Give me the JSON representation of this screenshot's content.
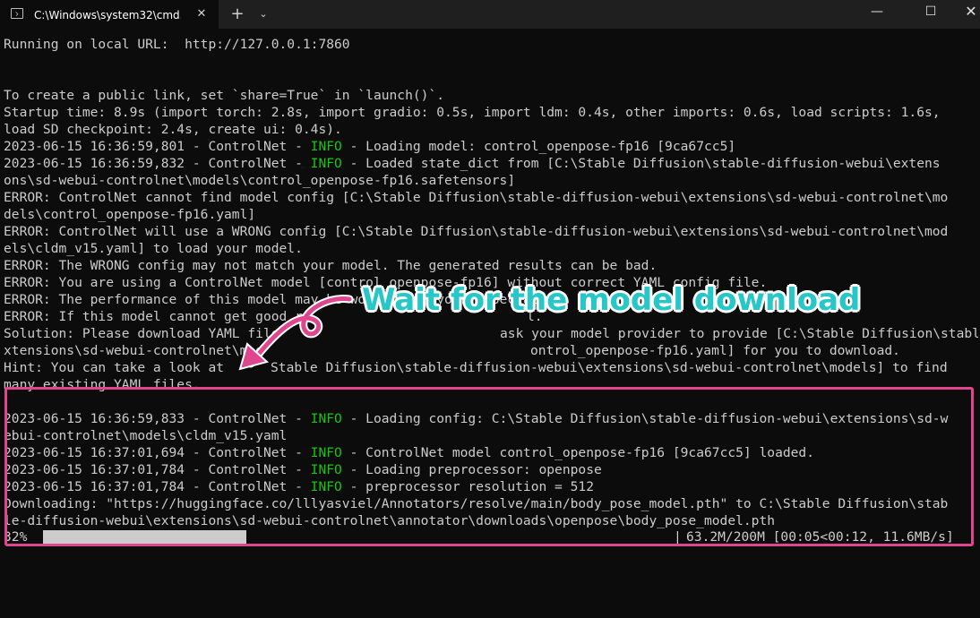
{
  "window": {
    "tab_title": "C:\\Windows\\system32\\cmd.e",
    "tab_close": "✕",
    "new_tab": "+",
    "dropdown": "⌄",
    "minimize": "—",
    "maximize": "☐",
    "close": "✕"
  },
  "console": {
    "lines": [
      "Running on local URL:  http://127.0.0.1:7860",
      "",
      "",
      "To create a public link, set `share=True` in `launch()`.",
      "Startup time: 8.9s (import torch: 2.8s, import gradio: 0.5s, import ldm: 0.4s, other imports: 0.6s, load scripts: 1.6s,",
      "load SD checkpoint: 2.4s, create ui: 0.4s).",
      [
        "2023-06-15 16:36:59,801 - ControlNet - ",
        "INFO",
        " - Loading model: control_openpose-fp16 [9ca67cc5]"
      ],
      [
        "2023-06-15 16:36:59,832 - ControlNet - ",
        "INFO",
        " - Loaded state_dict from [C:\\Stable Diffusion\\stable-diffusion-webui\\extens"
      ],
      "ons\\sd-webui-controlnet\\models\\control_openpose-fp16.safetensors]",
      "ERROR: ControlNet cannot find model config [C:\\Stable Diffusion\\stable-diffusion-webui\\extensions\\sd-webui-controlnet\\mo",
      "dels\\control_openpose-fp16.yaml]",
      "ERROR: ControlNet will use a WRONG config [C:\\Stable Diffusion\\stable-diffusion-webui\\extensions\\sd-webui-controlnet\\mod",
      "els\\cldm_v15.yaml] to load your model.",
      "ERROR: The WRONG config may not match your model. The generated results can be bad.",
      "ERROR: You are using a ControlNet model [control_openpose-fp16] without correct YAML config file.",
      "ERROR: The performance of this model may be worse than your expectation.",
      "ERROR: If this model cannot get good re",
      "Solution: Please download YAML file",
      "xtensions\\sd-webui-controlnet\\mod",
      "Hint: You can take a look at",
      "many existing YAML files.",
      "",
      [
        "2023-06-15 16:36:59,833 - ControlNet - ",
        "INFO",
        " - Loading config: C:\\Stable Diffusion\\stable-diffusion-webui\\extensions\\sd-w"
      ],
      "ebui-controlnet\\models\\cldm_v15.yaml",
      [
        "2023-06-15 16:37:01,694 - ControlNet - ",
        "INFO",
        " - ControlNet model control_openpose-fp16 [9ca67cc5] loaded."
      ],
      [
        "2023-06-15 16:37:01,784 - ControlNet - ",
        "INFO",
        " - Loading preprocessor: openpose"
      ],
      [
        "2023-06-15 16:37:01,784 - ControlNet - ",
        "INFO",
        " - preprocessor resolution = 512"
      ],
      "Downloading: \"https://huggingface.co/lllyasviel/Annotators/resolve/main/body_pose_model.pth\" to C:\\Stable Diffusion\\stab",
      "le-diffusion-webui\\extensions\\sd-webui-controlnet\\annotator\\downloads\\openpose\\body_pose_model.pth"
    ],
    "partial_tails": {
      "line16": "l.",
      "line17": "ask your model provider to provide [C:\\Stable Diffusion\\stable-diffusion-webui\\e",
      "line18": "ontrol_openpose-fp16.yaml] for you to download.",
      "line19": "Stable Diffusion\\stable-diffusion-webui\\extensions\\sd-webui-controlnet\\models] to find"
    }
  },
  "progress": {
    "percent_label": "32%",
    "fraction": 0.32,
    "end_marker": "|",
    "stats": "63.2M/200M [00:05<00:12, 11.6MB/s]"
  },
  "annotation": {
    "text": "Wait for the model download",
    "color": "#28c7c7",
    "box_color": "#e0468e"
  }
}
